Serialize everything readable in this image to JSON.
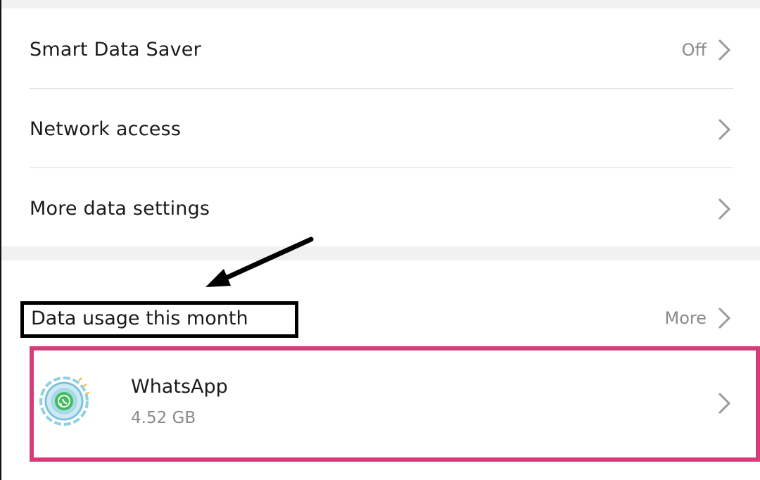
{
  "settings": {
    "items": [
      {
        "label": "Smart Data Saver",
        "value": "Off"
      },
      {
        "label": "Network access",
        "value": ""
      },
      {
        "label": "More data settings",
        "value": ""
      }
    ]
  },
  "usage": {
    "title": "Data usage this month",
    "more_label": "More",
    "apps": [
      {
        "name": "WhatsApp",
        "size": "4.52 GB",
        "icon": "whatsapp-icon"
      }
    ]
  },
  "colors": {
    "highlight_pink": "#d63b7a",
    "highlight_black": "#000000",
    "secondary_text": "#8a8a8a",
    "background": "#f1f1f1"
  }
}
